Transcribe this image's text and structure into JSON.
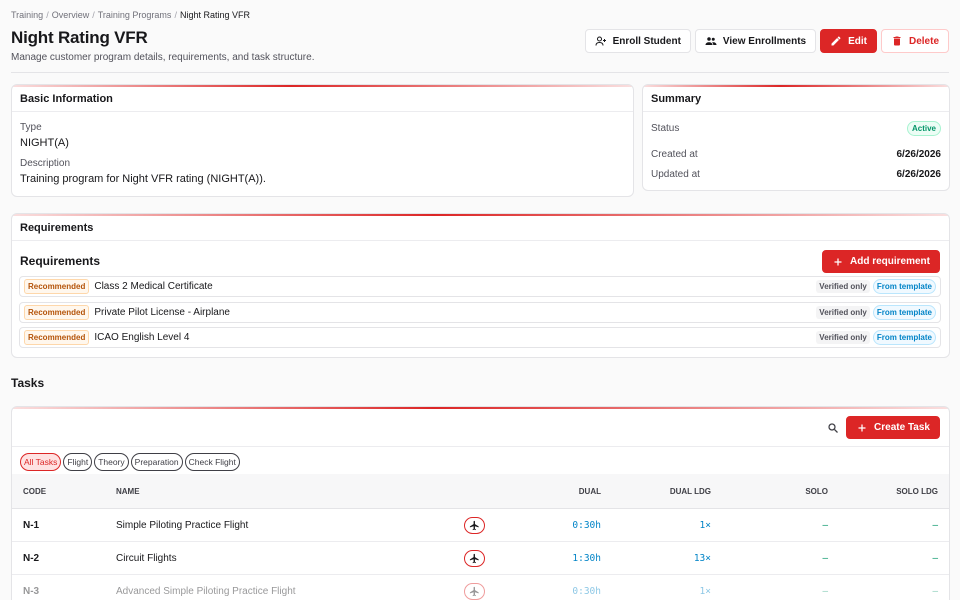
{
  "breadcrumb": [
    "Training",
    "Overview",
    "Training Programs",
    "Night Rating VFR"
  ],
  "page": {
    "title": "Night Rating VFR",
    "subtitle": "Manage customer program details, requirements, and task structure."
  },
  "actions": {
    "enroll": "Enroll Student",
    "view": "View Enrollments",
    "edit": "Edit",
    "delete": "Delete"
  },
  "basic": {
    "title": "Basic Information",
    "type_label": "Type",
    "type_value": "NIGHT(A)",
    "desc_label": "Description",
    "desc_value": "Training program for Night VFR rating (NIGHT(A))."
  },
  "summary": {
    "title": "Summary",
    "status_label": "Status",
    "status_value": "Active",
    "created_label": "Created at",
    "created_value": "6/26/2026",
    "updated_label": "Updated at",
    "updated_value": "6/26/2026"
  },
  "requirements": {
    "header": "Requirements",
    "subtitle": "Requirements",
    "add_label": "Add requirement",
    "items": [
      {
        "tag": "Recommended",
        "name": "Class 2 Medical Certificate",
        "verified": "Verified only",
        "source": "From template"
      },
      {
        "tag": "Recommended",
        "name": "Private Pilot License - Airplane",
        "verified": "Verified only",
        "source": "From template"
      },
      {
        "tag": "Recommended",
        "name": "ICAO English Level 4",
        "verified": "Verified only",
        "source": "From template"
      }
    ]
  },
  "tasks": {
    "title": "Tasks",
    "create_label": "Create Task",
    "filters": [
      "All Tasks",
      "Flight",
      "Theory",
      "Preparation",
      "Check Flight"
    ],
    "active_filter": "All Tasks",
    "columns": {
      "code": "CODE",
      "name": "NAME",
      "dual": "DUAL",
      "dual_ldg": "DUAL LDG",
      "solo": "SOLO",
      "solo_ldg": "SOLO LDG"
    },
    "rows": [
      {
        "code": "N-1",
        "name": "Simple Piloting Practice Flight",
        "type_icon": "airplane-icon",
        "dual": "0:30h",
        "dual_ldg": "1×",
        "solo": "–",
        "solo_ldg": "–"
      },
      {
        "code": "N-2",
        "name": "Circuit Flights",
        "type_icon": "airplane-icon",
        "dual": "1:30h",
        "dual_ldg": "13×",
        "solo": "–",
        "solo_ldg": "–"
      },
      {
        "code": "N-3",
        "name": "Advanced Simple Piloting Practice Flight",
        "type_icon": "airplane-icon",
        "dual": "0:30h",
        "dual_ldg": "1×",
        "solo": "–",
        "solo_ldg": "–"
      }
    ]
  },
  "colors": {
    "accent": "#dc2626",
    "success": "#059669",
    "info": "#0284c7",
    "warning": "#b45309"
  }
}
